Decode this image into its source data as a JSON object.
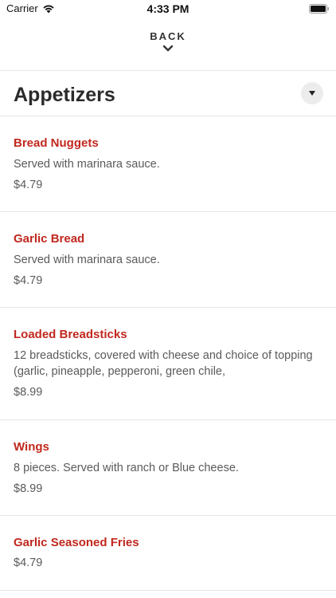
{
  "status_bar": {
    "carrier": "Carrier",
    "time": "4:33 PM",
    "icons": [
      "wifi-icon",
      "battery-icon"
    ]
  },
  "nav": {
    "back_label": "BACK",
    "back_icon": "chevron-down-icon"
  },
  "section": {
    "title": "Appetizers",
    "toggle_icon": "caret-down-icon"
  },
  "menu_items": [
    {
      "name": "Bread Nuggets",
      "description": "Served with marinara sauce.",
      "price": "$4.79"
    },
    {
      "name": "Garlic Bread",
      "description": "Served with marinara sauce.",
      "price": "$4.79"
    },
    {
      "name": "Loaded Breadsticks",
      "description": "12 breadsticks, covered with cheese and choice of topping (garlic, pineapple, pepperoni, green chile,",
      "price": "$8.99"
    },
    {
      "name": "Wings",
      "description": "8 pieces. Served with ranch or Blue cheese.",
      "price": "$8.99"
    },
    {
      "name": "Garlic Seasoned Fries",
      "description": "",
      "price": "$4.79"
    }
  ],
  "colors": {
    "item_name": "#c0281e",
    "text_secondary": "#5a5a5a",
    "divider": "#e6e6e6",
    "toggle_bg": "#ececec"
  }
}
